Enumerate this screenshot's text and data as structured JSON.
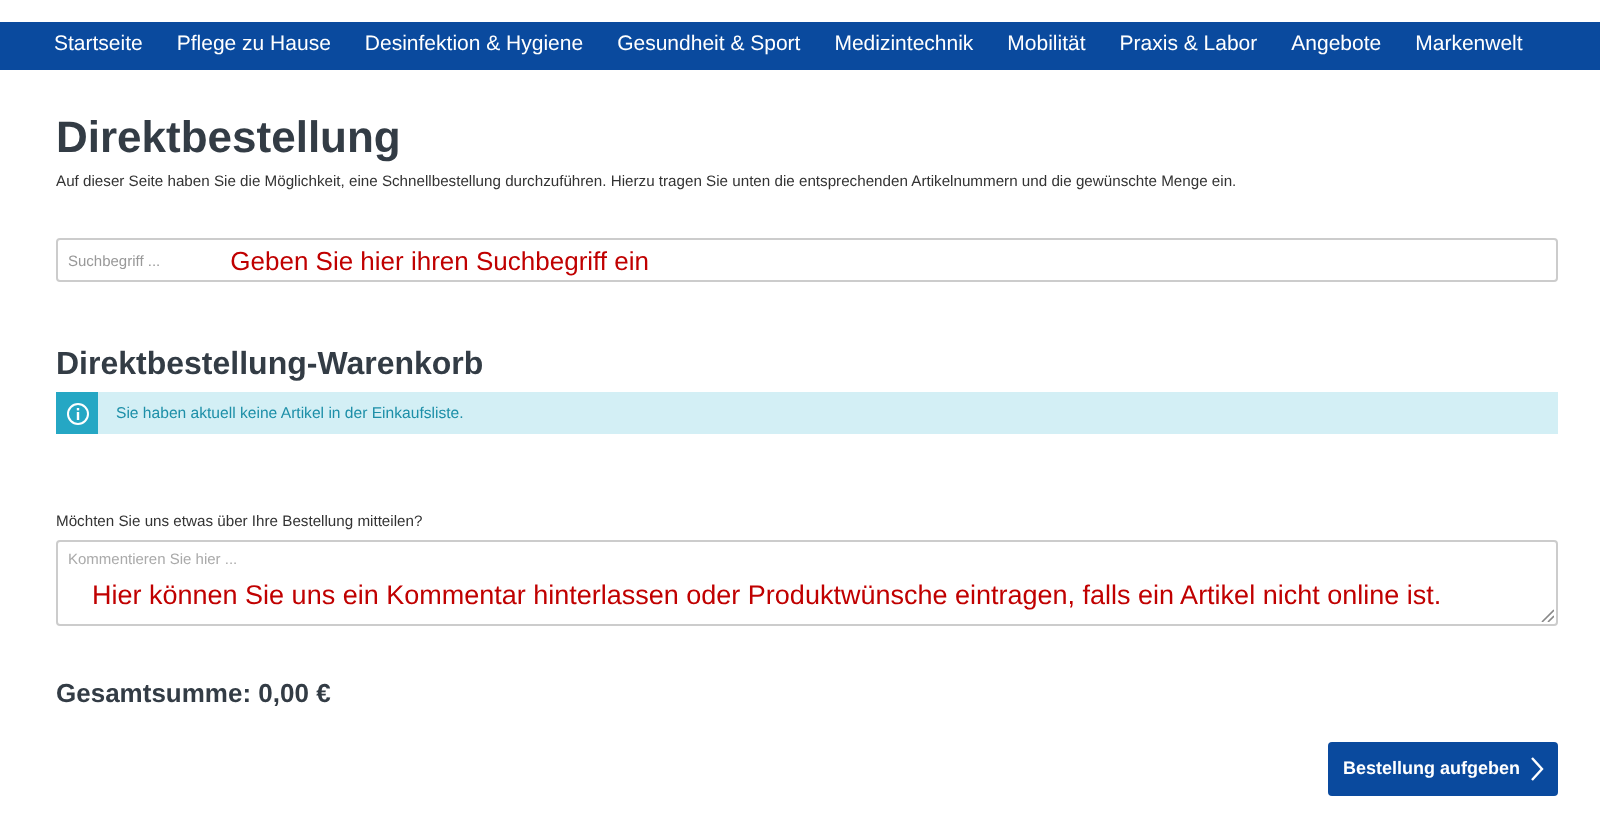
{
  "nav": [
    {
      "label": "Startseite"
    },
    {
      "label": "Pflege zu Hause"
    },
    {
      "label": "Desinfektion & Hygiene"
    },
    {
      "label": "Gesundheit & Sport"
    },
    {
      "label": "Medizintechnik"
    },
    {
      "label": "Mobilität"
    },
    {
      "label": "Praxis & Labor"
    },
    {
      "label": "Angebote"
    },
    {
      "label": "Markenwelt"
    }
  ],
  "title": "Direktbestellung",
  "intro": "Auf dieser Seite haben Sie die Möglichkeit, eine Schnellbestellung durchzuführen. Hierzu tragen Sie unten die entsprechenden Artikelnummern und die gewünschte Menge ein.",
  "search": {
    "placeholder": "Suchbegriff ...",
    "annotation": "Geben Sie hier ihren Suchbegriff ein"
  },
  "cart": {
    "heading": "Direktbestellung-Warenkorb",
    "info": "Sie haben aktuell keine Artikel in der Einkaufsliste."
  },
  "comment": {
    "label": "Möchten Sie uns etwas über Ihre Bestellung mitteilen?",
    "placeholder": "Kommentieren Sie hier ...",
    "annotation": "Hier können Sie uns ein Kommentar hinterlassen oder Produktwünsche eintragen, falls ein Artikel nicht online ist."
  },
  "total": "Gesamtsumme: 0,00 €",
  "submit": "Bestellung aufgeben"
}
